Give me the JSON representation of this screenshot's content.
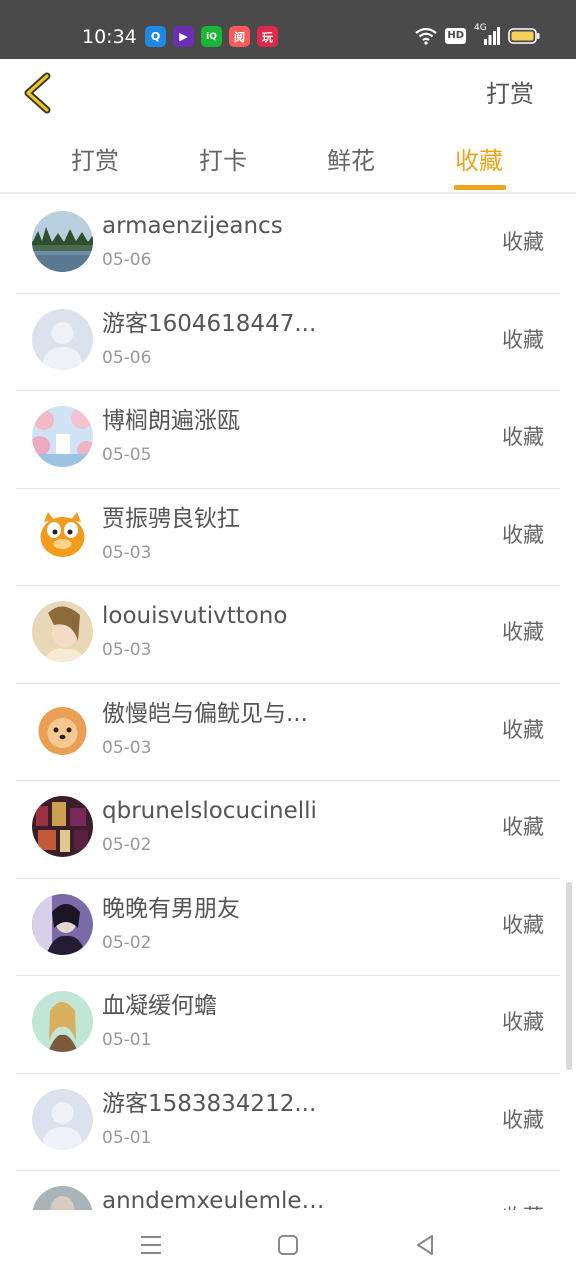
{
  "status_bar": {
    "time": "10:34",
    "notification_icons": [
      {
        "name": "browser-app-icon",
        "color": "#1e88e5",
        "glyph": "Q"
      },
      {
        "name": "video-app-icon",
        "color": "#6b2fb3",
        "glyph": "▶"
      },
      {
        "name": "iqiyi-app-icon",
        "color": "#18b735",
        "glyph": "iQ"
      },
      {
        "name": "reader-app-icon",
        "color": "#ff5a5a",
        "glyph": "阅"
      },
      {
        "name": "game-app-icon",
        "color": "#e0294a",
        "glyph": "玩"
      }
    ],
    "network_label": "4G",
    "hd_label": "HD"
  },
  "header": {
    "action_label": "打赏"
  },
  "tabs": [
    {
      "label": "打赏",
      "active": false
    },
    {
      "label": "打卡",
      "active": false
    },
    {
      "label": "鲜花",
      "active": false
    },
    {
      "label": "收藏",
      "active": true
    }
  ],
  "colors": {
    "accent": "#f0a41c",
    "status_bar": "#4a4a4a"
  },
  "list": {
    "items": [
      {
        "name": "armaenzijeancs",
        "date": "05-06",
        "action": "收藏",
        "avatar": "lake-landscape"
      },
      {
        "name": "游客1604618447...",
        "date": "05-06",
        "action": "收藏",
        "avatar": "default-user"
      },
      {
        "name": "博榈朗遍涨瓯",
        "date": "05-05",
        "action": "收藏",
        "avatar": "pink-blossom"
      },
      {
        "name": "贾振骋良钬扛",
        "date": "05-03",
        "action": "收藏",
        "avatar": "garfield"
      },
      {
        "name": "loouisvutivttono",
        "date": "05-03",
        "action": "收藏",
        "avatar": "woman-portrait"
      },
      {
        "name": "傲慢皑与偏鱿见与...",
        "date": "05-03",
        "action": "收藏",
        "avatar": "pomeranian-dog"
      },
      {
        "name": "qbrunelslocucinelli",
        "date": "05-02",
        "action": "收藏",
        "avatar": "city-night"
      },
      {
        "name": "晚晚有男朋友",
        "date": "05-02",
        "action": "收藏",
        "avatar": "girl-purple"
      },
      {
        "name": "血凝缓何蟾",
        "date": "05-01",
        "action": "收藏",
        "avatar": "girl-blonde"
      },
      {
        "name": "游客1583834212...",
        "date": "05-01",
        "action": "收藏",
        "avatar": "default-user"
      },
      {
        "name": "anndemxeulemlee...",
        "date": "",
        "action": "收藏",
        "avatar": "partial-portrait"
      }
    ]
  }
}
